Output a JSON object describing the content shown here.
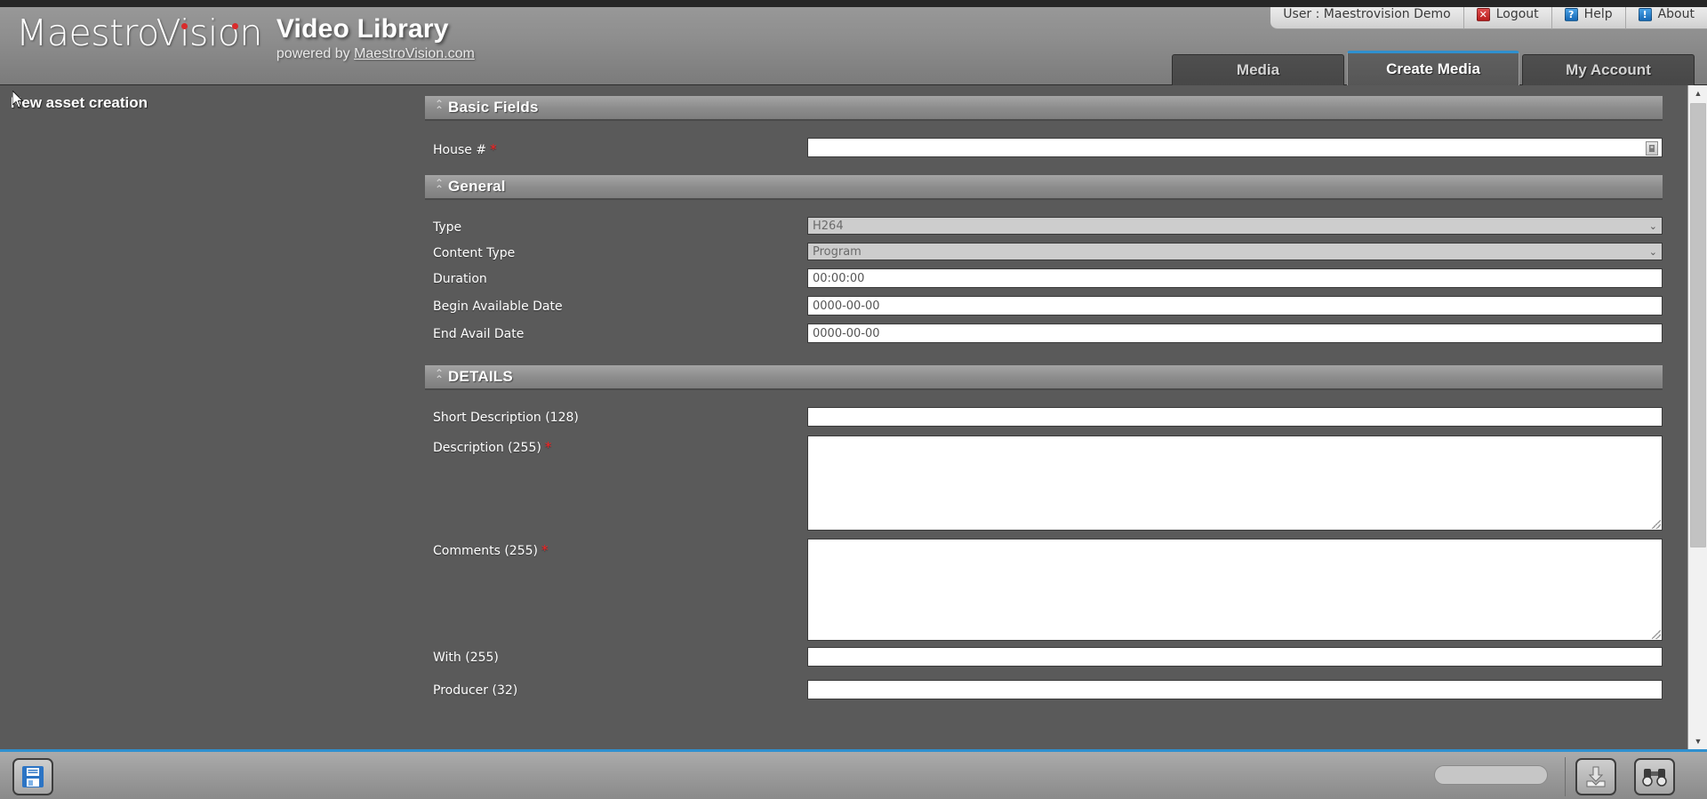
{
  "brand": {
    "logo_text": "MaestroVision",
    "app_title": "Video Library",
    "powered_prefix": "powered by ",
    "powered_link": "MaestroVision.com",
    "accent_blue": "#2f90cf",
    "required_red": "#ff2020"
  },
  "utilbar": {
    "user_label": "User : Maestrovision Demo",
    "logout_label": "Logout",
    "help_label": "Help",
    "about_label": "About",
    "logout_icon": "close-x-icon",
    "help_icon": "question-mark-icon",
    "about_icon": "exclamation-mark-icon"
  },
  "tabs": [
    {
      "label": "Media",
      "active": false
    },
    {
      "label": "Create Media",
      "active": true
    },
    {
      "label": "My Account",
      "active": false
    }
  ],
  "left_panel": {
    "heading": "New asset creation",
    "cursor_icon": "mouse-pointer-icon"
  },
  "sections": [
    {
      "id": "basic-fields",
      "title": "Basic Fields",
      "collapse_icon": "chevron-double-up-icon",
      "rows": [
        {
          "label": "House #",
          "required": true,
          "control": "text",
          "value": "",
          "picker_icon": "picker-icon"
        }
      ]
    },
    {
      "id": "general",
      "title": "General",
      "collapse_icon": "chevron-double-up-icon",
      "rows": [
        {
          "label": "Type",
          "required": false,
          "control": "select",
          "value": "H264",
          "arrow_icon": "chevron-down-icon"
        },
        {
          "label": "Content Type",
          "required": false,
          "control": "select",
          "value": "Program",
          "arrow_icon": "chevron-down-icon"
        },
        {
          "label": "Duration",
          "required": false,
          "control": "text",
          "value": "00:00:00"
        },
        {
          "label": "Begin Available Date",
          "required": false,
          "control": "text",
          "value": "0000-00-00"
        },
        {
          "label": "End Avail Date",
          "required": false,
          "control": "text",
          "value": "0000-00-00"
        }
      ]
    },
    {
      "id": "details",
      "title": "DETAILS",
      "collapse_icon": "chevron-double-up-icon",
      "rows": [
        {
          "label": "Short Description (128)",
          "required": false,
          "control": "text",
          "value": ""
        },
        {
          "label": "Description (255)",
          "required": true,
          "control": "textarea",
          "value": ""
        },
        {
          "label": "Comments (255)",
          "required": true,
          "control": "textarea",
          "value": ""
        },
        {
          "label": "With (255)",
          "required": false,
          "control": "text",
          "value": ""
        },
        {
          "label": "Producer (32)",
          "required": false,
          "control": "text",
          "value": ""
        }
      ]
    }
  ],
  "bottombar": {
    "save_icon": "floppy-disk-save-icon",
    "import_icon": "download-into-tray-icon",
    "browse_icon": "binoculars-icon",
    "progress_value": ""
  },
  "scrollbar": {
    "up_icon": "triangle-up-icon",
    "down_icon": "triangle-down-icon"
  }
}
